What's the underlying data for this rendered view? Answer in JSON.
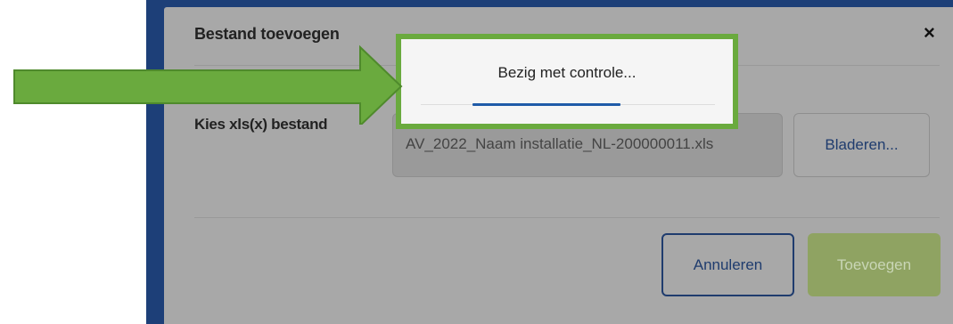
{
  "dialog": {
    "title": "Bestand toevoegen",
    "close_glyph": "×",
    "field_label": "Kies xls(x) bestand",
    "file_value": "AV_2022_Naam installatie_NL-200000011.xls",
    "browse_label": "Bladeren...",
    "cancel_label": "Annuleren",
    "add_label": "Toevoegen"
  },
  "progress": {
    "text": "Bezig met controle...",
    "value_fraction": 0.5
  },
  "colors": {
    "frame": "#1d3f78",
    "highlight_green": "#6aaa3e",
    "add_button": "#8fa362",
    "primary_blue": "#1f3c6e"
  },
  "icons": {
    "close": "close-icon",
    "arrow": "green-arrow-icon"
  }
}
